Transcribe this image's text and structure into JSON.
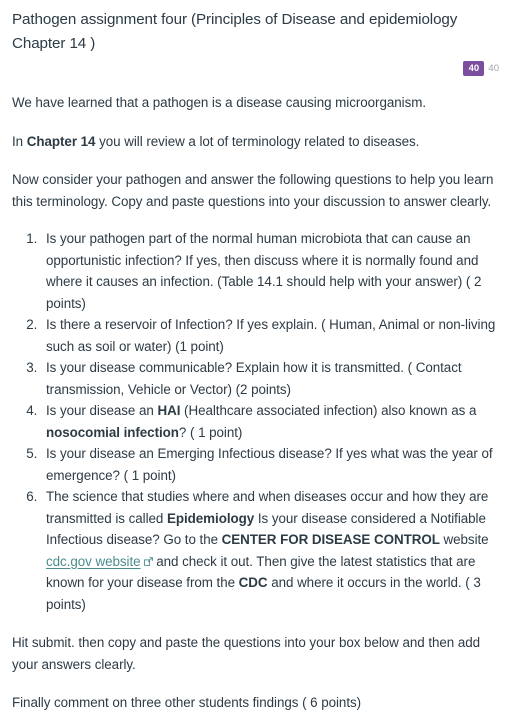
{
  "assignment": {
    "title": "Pathogen assignment four (Principles of Disease and epidemiology Chapter 14 )",
    "points_badge": "40",
    "points_secondary": "40"
  },
  "intro": {
    "paragraph_1": "We have learned that a pathogen is a disease causing microorganism.",
    "paragraph_2_before": "In ",
    "paragraph_2_bold": "Chapter 14",
    "paragraph_2_after": " you will review a lot of terminology related to diseases.",
    "paragraph_3": "Now consider your pathogen and answer the following questions to help you learn this terminology. Copy and paste questions into your discussion to answer clearly."
  },
  "questions": {
    "q1": "Is your pathogen part of the normal human microbiota that can cause  an opportunistic infection? If yes, then discuss where it is normally found and where it causes an infection. (Table 14.1 should help with your answer)  ( 2 points)",
    "q2": "Is there a reservoir of Infection? If yes explain. ( Human, Animal or non-living such as soil or water) (1 point)",
    "q3": "Is your disease communicable? Explain how it is transmitted. ( Contact transmission, Vehicle or Vector) (2 points)",
    "q4_part1": "Is your disease an ",
    "q4_bold1": "HAI",
    "q4_part2": " (Healthcare associated infection) also known as a ",
    "q4_bold2": "nosocomial infection",
    "q4_part3": "? ( 1 point)",
    "q5": "Is your disease an Emerging Infectious disease? If yes what was the year of emergence? ( 1 point)",
    "q6_part1": "The science that studies where and when diseases occur and how they are transmitted is called ",
    "q6_bold1": "Epidemiology",
    "q6_part2": "  Is your disease considered a Notifiable Infectious disease? Go to the ",
    "q6_bold2": "CENTER FOR DISEASE CONTROL",
    "q6_part3": " website ",
    "q6_link": "cdc.gov website",
    "q6_link_icon": "external-link-icon",
    "q6_part4": " and check it out. Then give the latest statistics that are known for your disease from the ",
    "q6_bold3": "CDC",
    "q6_part5": "  and where it occurs in the world. ( 3 points)"
  },
  "footer": {
    "submit_instructions": "Hit submit. then copy and paste the questions into your box below and then add your answers clearly.",
    "comment_instructions": "Finally comment on three other students findings ( 6 points)"
  },
  "colors": {
    "badge_purple": "#7b4e9e",
    "link_teal": "#4b8c8c",
    "text": "#2d3b45",
    "muted": "#9ea6ad"
  }
}
